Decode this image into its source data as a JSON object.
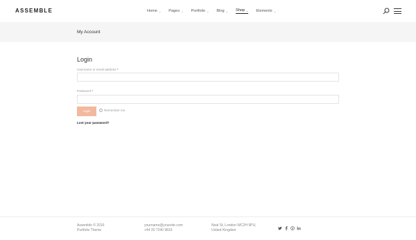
{
  "header": {
    "logo": "ASSEMBLE",
    "nav": [
      {
        "label": "Home",
        "chevron": "⌄"
      },
      {
        "label": "Pages",
        "chevron": "⌄"
      },
      {
        "label": "Portfolio",
        "chevron": "⌄"
      },
      {
        "label": "Blog",
        "chevron": "⌄"
      },
      {
        "label": "Shop",
        "chevron": "⌄"
      },
      {
        "label": "Elements",
        "chevron": "⌄"
      }
    ],
    "search_icon": "search-icon",
    "menu_icon": "hamburger-menu-icon"
  },
  "titlebar": {
    "title": "My Account"
  },
  "login": {
    "heading": "Login",
    "username_label": "Username or email address",
    "password_label": "Password",
    "required_mark": "*",
    "username_value": "",
    "password_value": "",
    "button_label": "Login",
    "remember_label": "Remember me",
    "lost_password": "Lost your password?"
  },
  "footer": {
    "col1": [
      "Assemble © 2016",
      "Portfolio Theme"
    ],
    "col2": [
      "yourname@yoursite.com",
      "+44 20 7240 9819"
    ],
    "col3": [
      "Neal St, London WC2H 9PU,",
      "United Kingdom"
    ],
    "social_icons": [
      "twitter-icon",
      "facebook-icon",
      "pinterest-icon",
      "linkedin-icon"
    ]
  },
  "colors": {
    "accent": "#f2b99f",
    "titlebar_bg": "#f5f5f5"
  }
}
